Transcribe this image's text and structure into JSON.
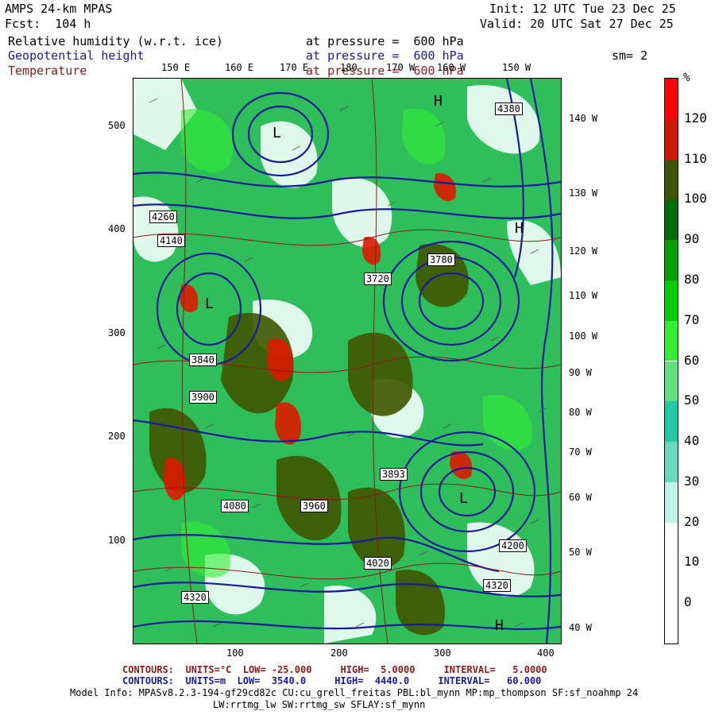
{
  "header": {
    "model": "AMPS 24-km MPAS",
    "fcst": "Fcst:  104 h",
    "init": "Init: 12 UTC Tue 23 Dec 25",
    "valid": "Valid: 20 UTC Sat 27 Dec 25",
    "field1": "Relative humidity (w.r.t. ice)",
    "field1_level": "at pressure =  600 hPa",
    "field2": "Geopotential height",
    "field2_level": "at pressure =  600 hPa",
    "field3": "Temperature",
    "field3_level": "at pressure =  600 hPa",
    "smoothing": "sm= 2"
  },
  "colors": {
    "background": "#ffffff",
    "height_contour": "#1a1a9c",
    "temperature_contour": "#8b1a1a",
    "rh_low": "#ffffff",
    "rh_high": "#ff0000"
  },
  "map": {
    "top_longitudes": [
      "150 E",
      "160 E",
      "170 E",
      "180",
      "170 W",
      "160 W",
      "150 W"
    ],
    "right_longitudes": [
      "140 W",
      "130 W",
      "120 W",
      "110 W",
      "100 W",
      "90 W",
      "80 W",
      "70 W",
      "60 W",
      "50 W",
      "40 W"
    ],
    "y_ticks": [
      "500",
      "400",
      "300",
      "200",
      "100"
    ],
    "x_ticks": [
      "100",
      "200",
      "300",
      "400"
    ],
    "height_labels": [
      "4380",
      "4320",
      "4260",
      "4200",
      "4140",
      "4080",
      "4020",
      "3960",
      "3900",
      "3840",
      "3780",
      "3720",
      "3893",
      "4260",
      "4140",
      "4380",
      "4320"
    ],
    "pressure_centers": [
      "H",
      "L",
      "H",
      "L",
      "L",
      "H"
    ]
  },
  "colorbar": {
    "unit": "%",
    "ticks": [
      "120",
      "110",
      "100",
      "90",
      "80",
      "70",
      "60",
      "50",
      "40",
      "30",
      "20",
      "10",
      "0"
    ],
    "segment_colors": [
      "#ff0000",
      "#cc1a00",
      "#3f5500",
      "#006b00",
      "#00a000",
      "#00cc00",
      "#33ee33",
      "#5fdf7f",
      "#22c9a5",
      "#66d9bf",
      "#bff2e6",
      "#ffffff",
      "#ffffff",
      "#ffffff"
    ]
  },
  "footer": {
    "temp_contours": "CONTOURS:  UNITS=°C  LOW= -25.000     HIGH=  5.0000     INTERVAL=   5.0000",
    "hgt_contours": "CONTOURS:  UNITS=m  LOW=  3540.0     HIGH=  4440.0     INTERVAL=   60.000",
    "model_info": "Model Info: MPASv8.2.3-194-gf29cd82c CU:cu_grell_freitas PBL:bl_mynn MP:mp_thompson SF:sf_noahmp 24",
    "model_info2": "LW:rrtmg_lw SW:rrtmg_sw SFLAY:sf_mynn"
  }
}
